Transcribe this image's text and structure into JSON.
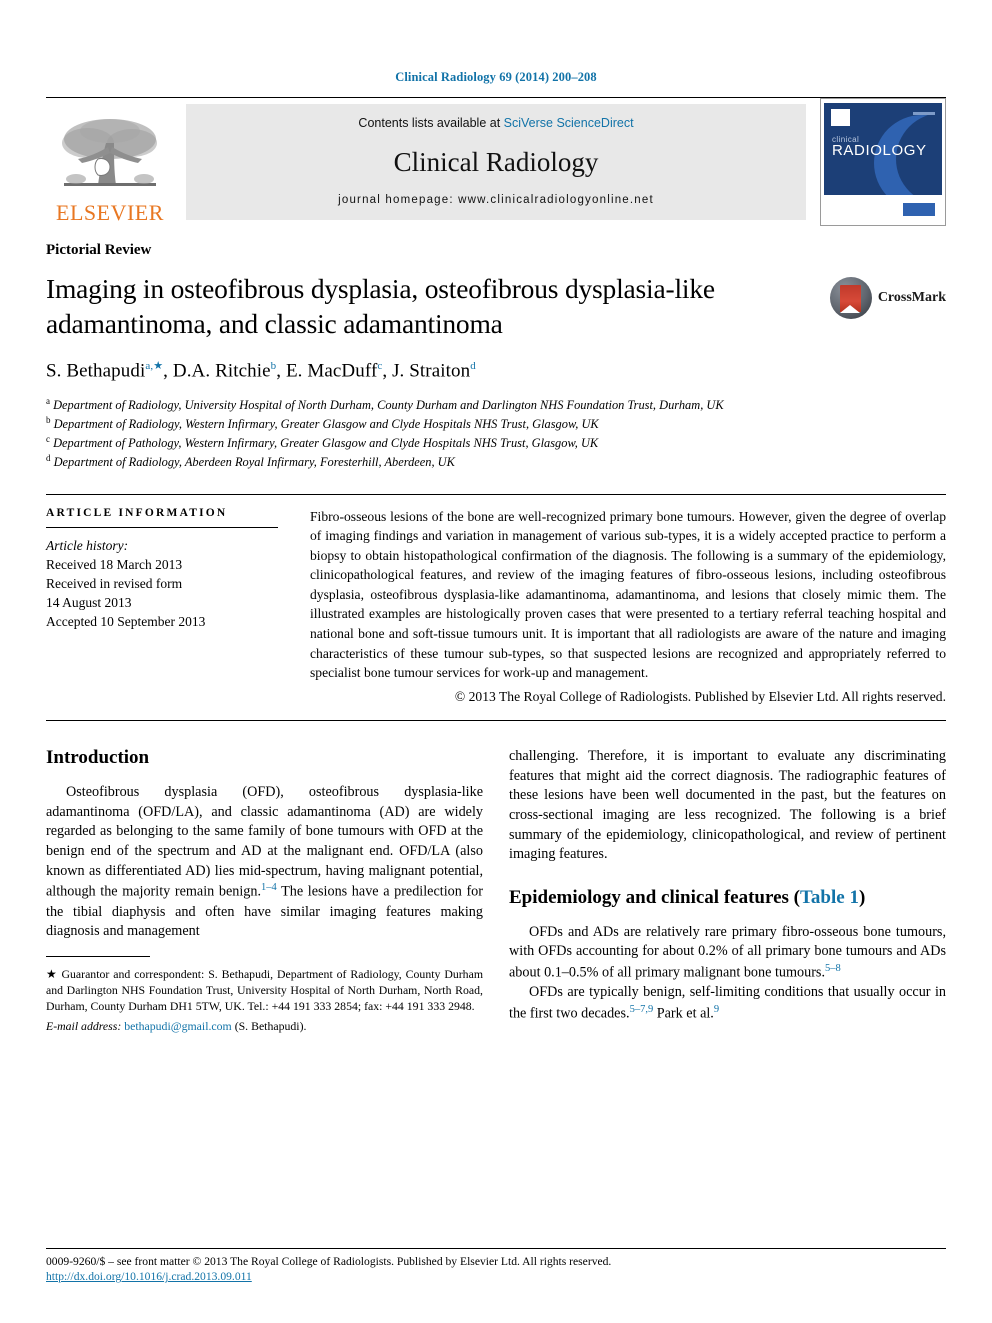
{
  "running_head": "Clinical Radiology 69 (2014) 200–208",
  "masthead": {
    "publisher_logo_label": "ELSEVIER",
    "contents_prefix": "Contents lists available at ",
    "contents_link": "SciVerse ScienceDirect",
    "journal_name": "Clinical Radiology",
    "homepage_line": "journal homepage: www.clinicalradiologyonline.net",
    "cover": {
      "small_title": "clinical",
      "big_title": "RADIOLOGY"
    }
  },
  "article": {
    "type": "Pictorial Review",
    "title": "Imaging in osteofibrous dysplasia, osteofibrous dysplasia-like adamantinoma, and classic adamantinoma",
    "crossmark_label": "CrossMark",
    "authors": [
      {
        "name": "S. Bethapudi",
        "marks": "a,★"
      },
      {
        "name": "D.A. Ritchie",
        "marks": "b"
      },
      {
        "name": "E. MacDuff",
        "marks": "c"
      },
      {
        "name": "J. Straiton",
        "marks": "d"
      }
    ],
    "affiliations": [
      {
        "mark": "a",
        "text": "Department of Radiology, University Hospital of North Durham, County Durham and Darlington NHS Foundation Trust, Durham, UK"
      },
      {
        "mark": "b",
        "text": "Department of Radiology, Western Infirmary, Greater Glasgow and Clyde Hospitals NHS Trust, Glasgow, UK"
      },
      {
        "mark": "c",
        "text": "Department of Pathology, Western Infirmary, Greater Glasgow and Clyde Hospitals NHS Trust, Glasgow, UK"
      },
      {
        "mark": "d",
        "text": "Department of Radiology, Aberdeen Royal Infirmary, Foresterhill, Aberdeen, UK"
      }
    ]
  },
  "article_information": {
    "heading": "ARTICLE INFORMATION",
    "history_label": "Article history:",
    "history_lines": [
      "Received 18 March 2013",
      "Received in revised form",
      "14 August 2013",
      "Accepted 10 September 2013"
    ]
  },
  "abstract": {
    "text": "Fibro-osseous lesions of the bone are well-recognized primary bone tumours. However, given the degree of overlap of imaging findings and variation in management of various sub-types, it is a widely accepted practice to perform a biopsy to obtain histopathological confirmation of the diagnosis. The following is a summary of the epidemiology, clinicopathological features, and review of the imaging features of fibro-osseous lesions, including osteofibrous dysplasia, osteofibrous dysplasia-like adamantinoma, adamantinoma, and lesions that closely mimic them. The illustrated examples are histologically proven cases that were presented to a tertiary referral teaching hospital and national bone and soft-tissue tumours unit. It is important that all radiologists are aware of the nature and imaging characteristics of these tumour sub-types, so that suspected lesions are recognized and appropriately referred to specialist bone tumour services for work-up and management.",
    "copyright": "© 2013 The Royal College of Radiologists. Published by Elsevier Ltd. All rights reserved."
  },
  "body": {
    "left": {
      "heading": "Introduction",
      "paragraph_1_part1": "Osteofibrous dysplasia (OFD), osteofibrous dysplasia-like adamantinoma (OFD/LA), and classic adamantinoma (AD) are widely regarded as belonging to the same family of bone tumours with OFD at the benign end of the spectrum and AD at the malignant end. OFD/LA (also known as differentiated AD) lies mid-spectrum, having malignant potential, although the majority remain benign.",
      "paragraph_1_ref": "1–4",
      "paragraph_1_part2": " The lesions have a predilection for the tibial diaphysis and often have similar imaging features making diagnosis and management"
    },
    "right": {
      "continuation": "challenging. Therefore, it is important to evaluate any discriminating features that might aid the correct diagnosis. The radiographic features of these lesions have been well documented in the past, but the features on cross-sectional imaging are less recognized. The following is a brief summary of the epidemiology, clinicopathological, and review of pertinent imaging features.",
      "heading": "Epidemiology and clinical features",
      "heading_table_ref": "Table 1",
      "paragraph_1_part1": "OFDs and ADs are relatively rare primary fibro-osseous bone tumours, with OFDs accounting for about 0.2% of all primary bone tumours and ADs about 0.1–0.5% of all primary malignant bone tumours.",
      "paragraph_1_ref": "5–8",
      "paragraph_2_part1": "OFDs are typically benign, self-limiting conditions that usually occur in the first two decades.",
      "paragraph_2_ref": "5–7,9",
      "paragraph_2_part2": " Park et al.",
      "paragraph_2_ref2": "9"
    }
  },
  "footnote": {
    "correspondence": "★ Guarantor and correspondent: S. Bethapudi, Department of Radiology, County Durham and Darlington NHS Foundation Trust, University Hospital of North Durham, North Road, Durham, County Durham DH1 5TW, UK. Tel.: +44 191 333 2854; fax: +44 191 333 2948.",
    "email_label": "E-mail address:",
    "email": "bethapudi@gmail.com",
    "email_suffix": "(S. Bethapudi)."
  },
  "page_footer": {
    "line": "0009-9260/$ – see front matter © 2013 The Royal College of Radiologists. Published by Elsevier Ltd. All rights reserved.",
    "doi": "http://dx.doi.org/10.1016/j.crad.2013.09.011"
  },
  "colors": {
    "link": "#1273a8",
    "elsevier_orange": "#E87722",
    "cover_blue": "#1c3f77",
    "crossmark_red": "#c0392b"
  }
}
